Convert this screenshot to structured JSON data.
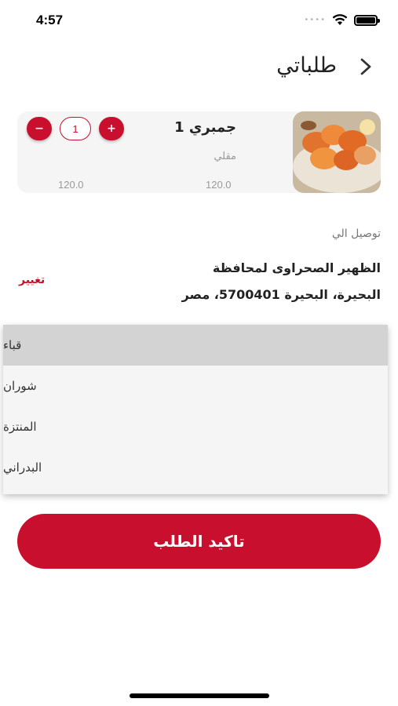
{
  "status_bar": {
    "time": "4:57",
    "signal_icon": "signal-dots-icon",
    "wifi_icon": "wifi-icon",
    "battery_icon": "battery-icon"
  },
  "header": {
    "title": "طلباتي",
    "back_icon": "chevron-right-icon"
  },
  "cart_item": {
    "name": "جمبري 1",
    "variant": "مقلي",
    "unit_price": "120.0",
    "total_price": "120.0",
    "quantity": "1",
    "decrease_label": "−",
    "increase_label": "+"
  },
  "delivery": {
    "label": "توصيل الي",
    "address_line1": "الظهير الصحراوى لمحافظة",
    "address_line2": "البحيرة، البحيرة 5700401، مصر",
    "change_label": "تغيير"
  },
  "dropdown": {
    "options": [
      "قباء",
      "شوران",
      "المنتزة",
      "البدراني"
    ],
    "selected": "قباء"
  },
  "confirm_button": {
    "label": "تاكيد الطلب"
  },
  "colors": {
    "accent": "#c8102e",
    "card_bg": "#f5f5f5",
    "selected_bg": "#d3d3d3"
  }
}
